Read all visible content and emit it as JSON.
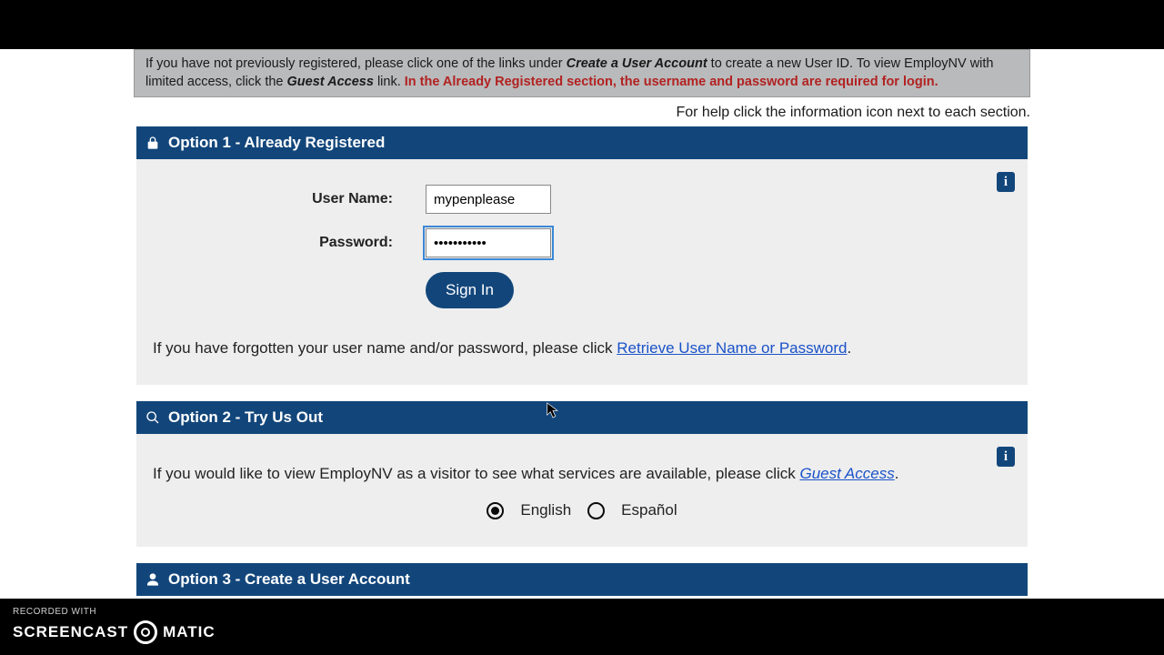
{
  "notice": {
    "pre": "If you have not previously registered, please click one of the links under ",
    "create_em": "Create a User Account",
    "mid": " to create a new User ID. To view EmployNV with limited access, click the ",
    "guest_em": "Guest Access",
    "post_link": " link. ",
    "red": "In the Already Registered section, the username and password are required for login."
  },
  "help_line": "For help click the information icon next to each section.",
  "option1": {
    "title": "Option 1 - Already Registered",
    "username_label": "User Name:",
    "username_value": "mypenplease",
    "password_label": "Password:",
    "password_value": "•••••••••••",
    "signin_label": "Sign In",
    "forgot_pre": "If you have forgotten your user name and/or password, please click  ",
    "forgot_link": "Retrieve User Name or Password",
    "forgot_post": "."
  },
  "option2": {
    "title": "Option 2 - Try Us Out",
    "guest_pre": "If you would like to view EmployNV as a visitor to see what services are available, please click ",
    "guest_link": "Guest Access",
    "guest_post": ".",
    "lang_english": "English",
    "lang_spanish": "Español",
    "selected_lang": "english"
  },
  "option3": {
    "title": "Option 3 - Create a User Account"
  },
  "watermark": {
    "recorded_with": "RECORDED WITH",
    "brand_left": "SCREENCAST",
    "brand_right": "MATIC"
  },
  "info_glyph": "i"
}
